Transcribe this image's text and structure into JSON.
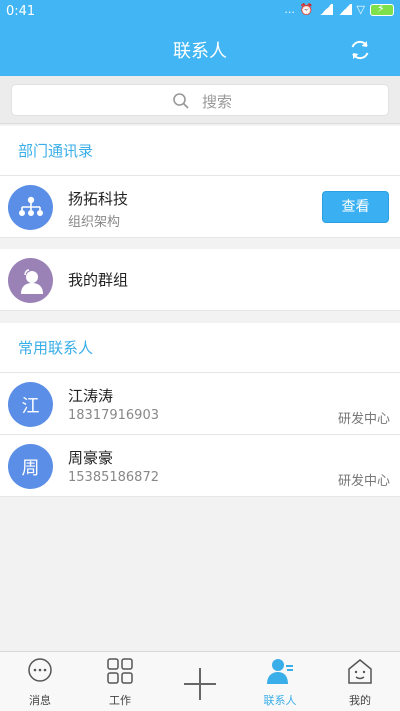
{
  "status_bar": {
    "time": "0:41",
    "dots": "...",
    "wifi_glyph": "▽"
  },
  "header": {
    "title": "联系人",
    "refresh_icon": "refresh-icon"
  },
  "search": {
    "placeholder": "搜索"
  },
  "department_section": {
    "header": "部门通讯录",
    "org": {
      "name": "扬拓科技",
      "subtitle": "组织架构",
      "button": "查看",
      "icon": "org-chart-icon",
      "color": "#5b8ee6"
    }
  },
  "groups": {
    "label": "我的群组",
    "icon": "group-person-icon",
    "color": "#9a82b7"
  },
  "frequent_section": {
    "header": "常用联系人",
    "contacts": [
      {
        "avatar_char": "江",
        "name": "江涛涛",
        "phone": "18317916903",
        "dept": "研发中心",
        "color": "#5b8ee6"
      },
      {
        "avatar_char": "周",
        "name": "周豪豪",
        "phone": "15385186872",
        "dept": "研发中心",
        "color": "#5b8ee6"
      }
    ]
  },
  "tabs": [
    {
      "label": "消息",
      "icon": "chat-bubble-icon",
      "active": false
    },
    {
      "label": "工作",
      "icon": "grid-icon",
      "active": false
    },
    {
      "label": "",
      "icon": "plus-icon",
      "active": false
    },
    {
      "label": "联系人",
      "icon": "contacts-icon",
      "active": true
    },
    {
      "label": "我的",
      "icon": "home-face-icon",
      "active": false
    }
  ],
  "colors": {
    "primary": "#42b6f4",
    "accent_text": "#3aaee8",
    "button": "#3ab0f2"
  }
}
